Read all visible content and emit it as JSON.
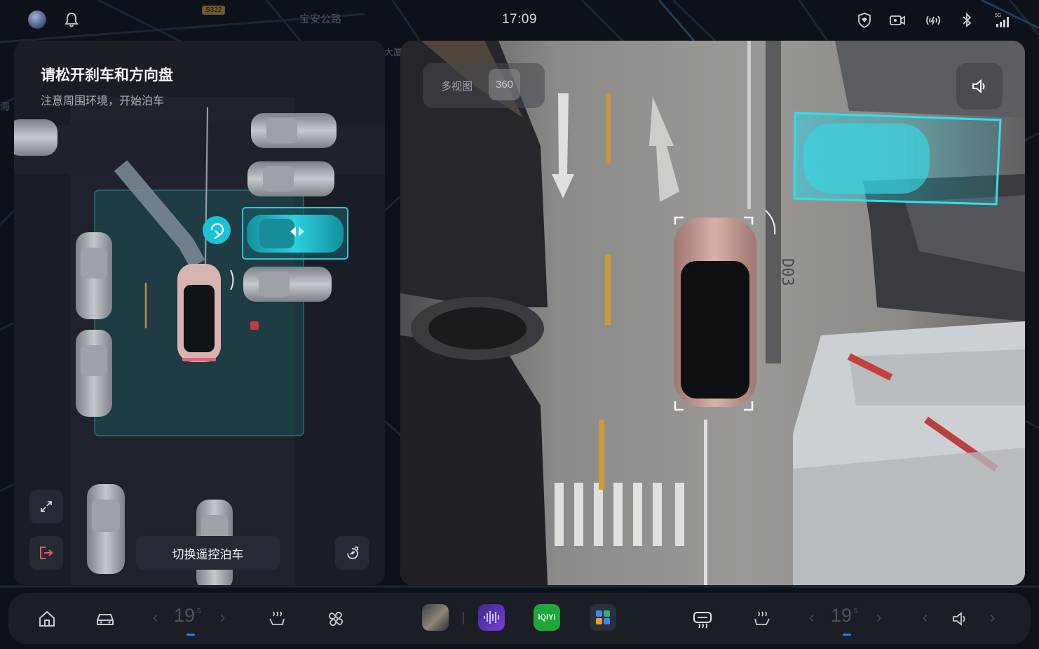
{
  "status_bar": {
    "time": "17:09",
    "map_road_label": "宝安公路",
    "map_road_badge": "S322",
    "map_side_label": "海",
    "map_small_label": "大厦",
    "icons": [
      "avatar-icon",
      "bell-icon",
      "shield-icon",
      "dashcam-icon",
      "hotspot-icon",
      "bluetooth-icon",
      "signal-5g-icon"
    ],
    "signal_label": "5G"
  },
  "parking_panel": {
    "title": "请松开刹车和方向盘",
    "subtitle": "注意周围环境，开始泊车",
    "switch_button": "切换遥控泊车",
    "accent_color": "#2cc6d6",
    "exit_color": "#f05a4a"
  },
  "camera_view": {
    "tab_multi": "多视图",
    "tab_360": "360",
    "slot_label": "D03",
    "slot_highlight_color": "#27d3e4"
  },
  "dock": {
    "temp_left": "19",
    "temp_left_decimal": ".5",
    "temp_right": "19",
    "temp_right_decimal": ".5",
    "icons": [
      "home-icon",
      "car-icon",
      "seat-heat-icon",
      "fan-icon",
      "defrost-icon",
      "seat-heat-right-icon",
      "volume-icon"
    ],
    "apps": [
      "media-app",
      "voice-app",
      "iqiyi-app",
      "apps-grid"
    ],
    "iqiyi_label": "iQIYI"
  }
}
